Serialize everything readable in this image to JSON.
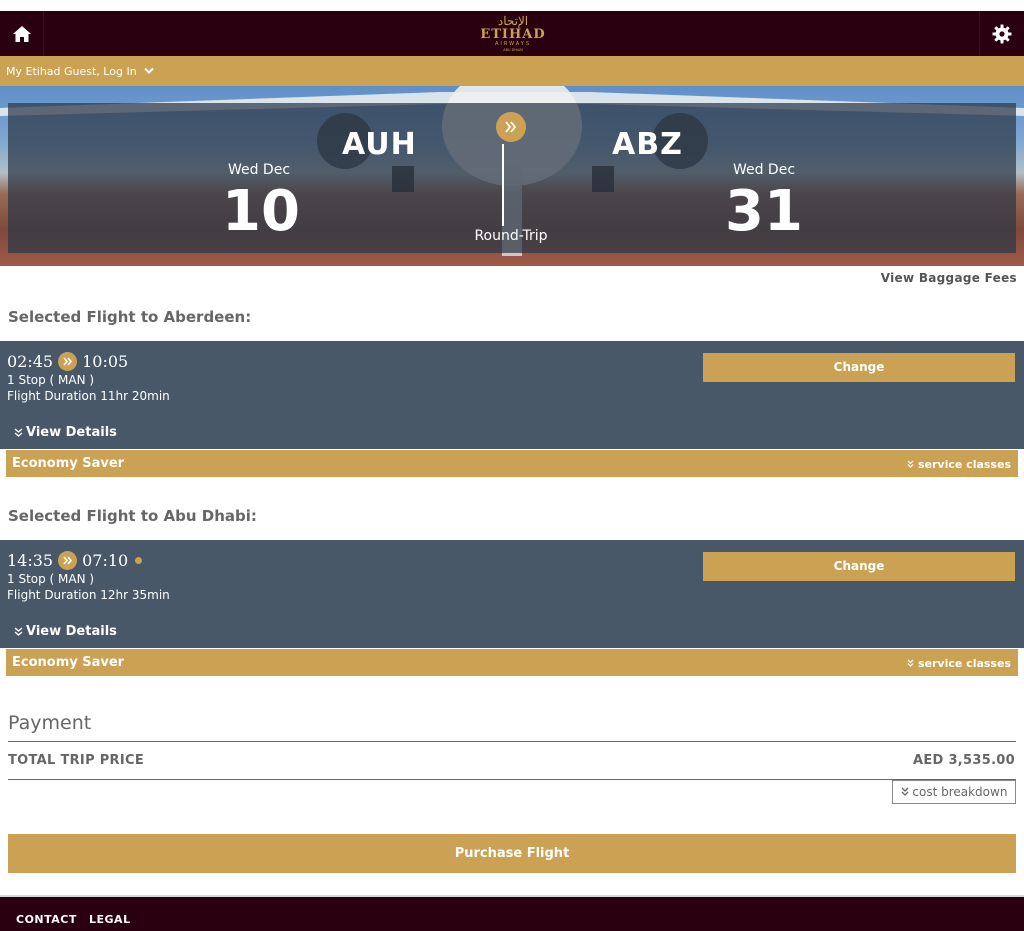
{
  "header": {
    "logo_ar": "الإتحاد",
    "logo_en": "ETIHAD",
    "logo_sub": "AIRWAYS",
    "logo_city": "ABU DHABI"
  },
  "userbar": {
    "label": "My Etihad Guest, Log In"
  },
  "hero": {
    "origin": "AUH",
    "destination": "ABZ",
    "depart_month": "Wed Dec",
    "depart_day": "10",
    "return_month": "Wed Dec",
    "return_day": "31",
    "trip_type": "Round-Trip"
  },
  "baggage_link": "View Baggage Fees",
  "outbound": {
    "title": "Selected Flight to Aberdeen:",
    "depart": "02:45",
    "arrive": "10:05",
    "stops": "1 Stop ( MAN )",
    "duration": "Flight Duration 11hr 20min",
    "details": "View Details",
    "change": "Change",
    "cabin": "Economy Saver",
    "service": "service classes"
  },
  "inbound": {
    "title": "Selected Flight to Abu Dhabi:",
    "depart": "14:35",
    "arrive": "07:10",
    "stops": "1 Stop ( MAN )",
    "duration": "Flight Duration 12hr 35min",
    "details": "View Details",
    "change": "Change",
    "cabin": "Economy Saver",
    "service": "service classes"
  },
  "payment": {
    "title": "Payment",
    "total_label": "TOTAL TRIP PRICE",
    "total_value": "AED 3,535.00",
    "breakdown": "cost breakdown",
    "purchase": "Purchase Flight"
  },
  "footer": {
    "contact": "CONTACT",
    "legal": "LEGAL"
  },
  "colors": {
    "brand_dark": "#2a0010",
    "gold": "#cba254",
    "slate": "#485868"
  }
}
